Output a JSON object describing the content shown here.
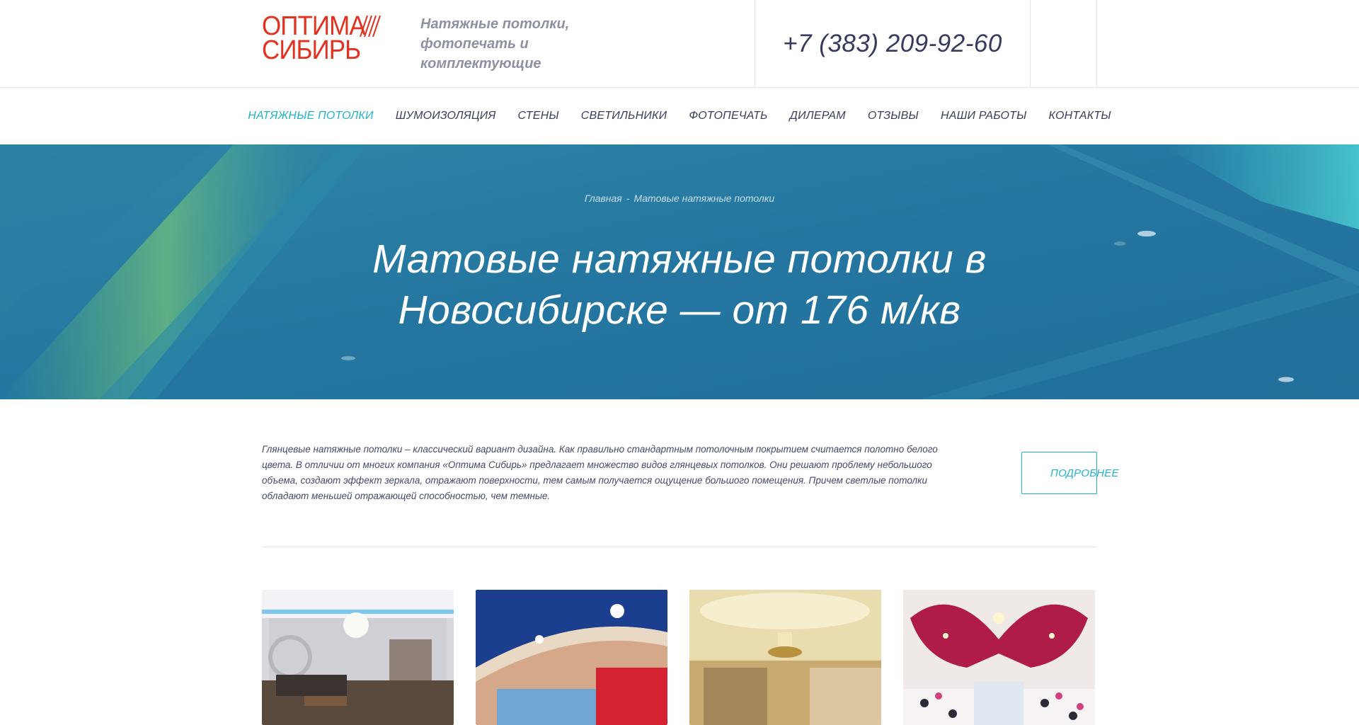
{
  "header": {
    "logo": {
      "line1": "ОПТИМА",
      "line2": "СИБИРЬ",
      "color": "#e2321f"
    },
    "tagline": [
      "Натяжные потолки,",
      "фотопечать и",
      "комплектующие"
    ],
    "phone": "+7 (383) 209-92-60"
  },
  "nav": {
    "items": [
      {
        "label": "НАТЯЖНЫЕ ПОТОЛКИ",
        "active": true
      },
      {
        "label": "ШУМОИЗОЛЯЦИЯ"
      },
      {
        "label": "СТЕНЫ"
      },
      {
        "label": "СВЕТИЛЬНИКИ"
      },
      {
        "label": "ФОТОПЕЧАТЬ"
      },
      {
        "label": "ДИЛЕРАМ"
      },
      {
        "label": "ОТЗЫВЫ"
      },
      {
        "label": "НАШИ РАБОТЫ"
      },
      {
        "label": "КОНТАКТЫ"
      }
    ],
    "active_color": "#22b3c9"
  },
  "hero": {
    "breadcrumb": {
      "home": "Главная",
      "separator": "-",
      "current": "Матовые натяжные потолки"
    },
    "title_line1": "Матовые натяжные потолки в",
    "title_line2": "Новосибирске — от 176 м/кв",
    "background_color": "#2778a0"
  },
  "content": {
    "intro": "Глянцевые натяжные потолки – классический вариант дизайна. Как правильно стандартным потолочным покрытием считается полотно белого цвета. В отличии от многих компания «Оптима Сибирь» предлагает множество видов глянцевых потолков. Они решают проблему небольшого объема, создают эффект зеркала, отражают поверхности, тем самым получается ощущение большого помещения. Причем светлые потолки обладают меньшей отражающей способностью, чем темные.",
    "more_button": "ПОДРОБНЕЕ"
  },
  "gallery": {
    "items": [
      {
        "icon": "ceiling-photo-living-room"
      },
      {
        "icon": "ceiling-photo-blue-red"
      },
      {
        "icon": "ceiling-photo-golden"
      },
      {
        "icon": "ceiling-photo-butterfly"
      }
    ]
  }
}
